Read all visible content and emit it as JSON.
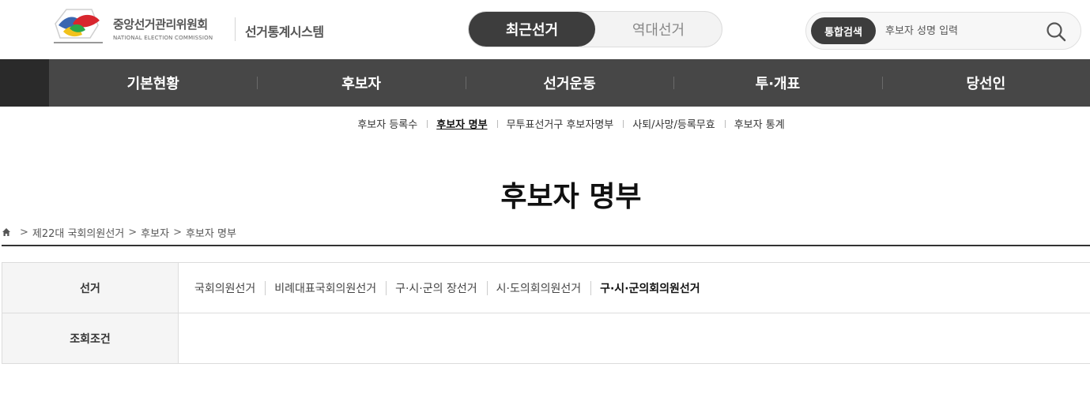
{
  "header": {
    "org_name": "중앙선거관리위원회",
    "org_name_en": "NATIONAL ELECTION COMMISSION",
    "system_name": "선거통계시스템",
    "toggle": {
      "recent": "최근선거",
      "history": "역대선거"
    },
    "search": {
      "tag": "통합검색",
      "placeholder": "후보자 성명 입력"
    }
  },
  "nav": {
    "items": [
      {
        "label": "기본현황"
      },
      {
        "label": "후보자"
      },
      {
        "label": "선거운동"
      },
      {
        "label": "투·개표"
      },
      {
        "label": "당선인"
      }
    ]
  },
  "subnav": {
    "items": [
      {
        "label": "후보자 등록수"
      },
      {
        "label": "후보자 명부"
      },
      {
        "label": "무투표선거구 후보자명부"
      },
      {
        "label": "사퇴/사망/등록무효"
      },
      {
        "label": "후보자 통계"
      }
    ],
    "active_index": 1
  },
  "page": {
    "title": "후보자 명부"
  },
  "breadcrumb": {
    "sep": ">",
    "items": [
      "제22대 국회의원선거",
      "후보자",
      "후보자 명부"
    ]
  },
  "form": {
    "election_label": "선거",
    "condition_label": "조회조건",
    "elections": [
      {
        "label": "국회의원선거"
      },
      {
        "label": "비례대표국회의원선거"
      },
      {
        "label": "구·시·군의 장선거"
      },
      {
        "label": "시·도의회의원선거"
      },
      {
        "label": "구·시·군의회의원선거"
      }
    ]
  },
  "colors": {
    "nav_bg": "#474747",
    "nav_left_bg": "#2a2a2a",
    "toggle_active": "#3d3d3d",
    "label_bg": "#f5f5f5"
  },
  "icons": {
    "logo": "nec-bird-logo",
    "search": "search-icon",
    "home": "home-icon"
  }
}
